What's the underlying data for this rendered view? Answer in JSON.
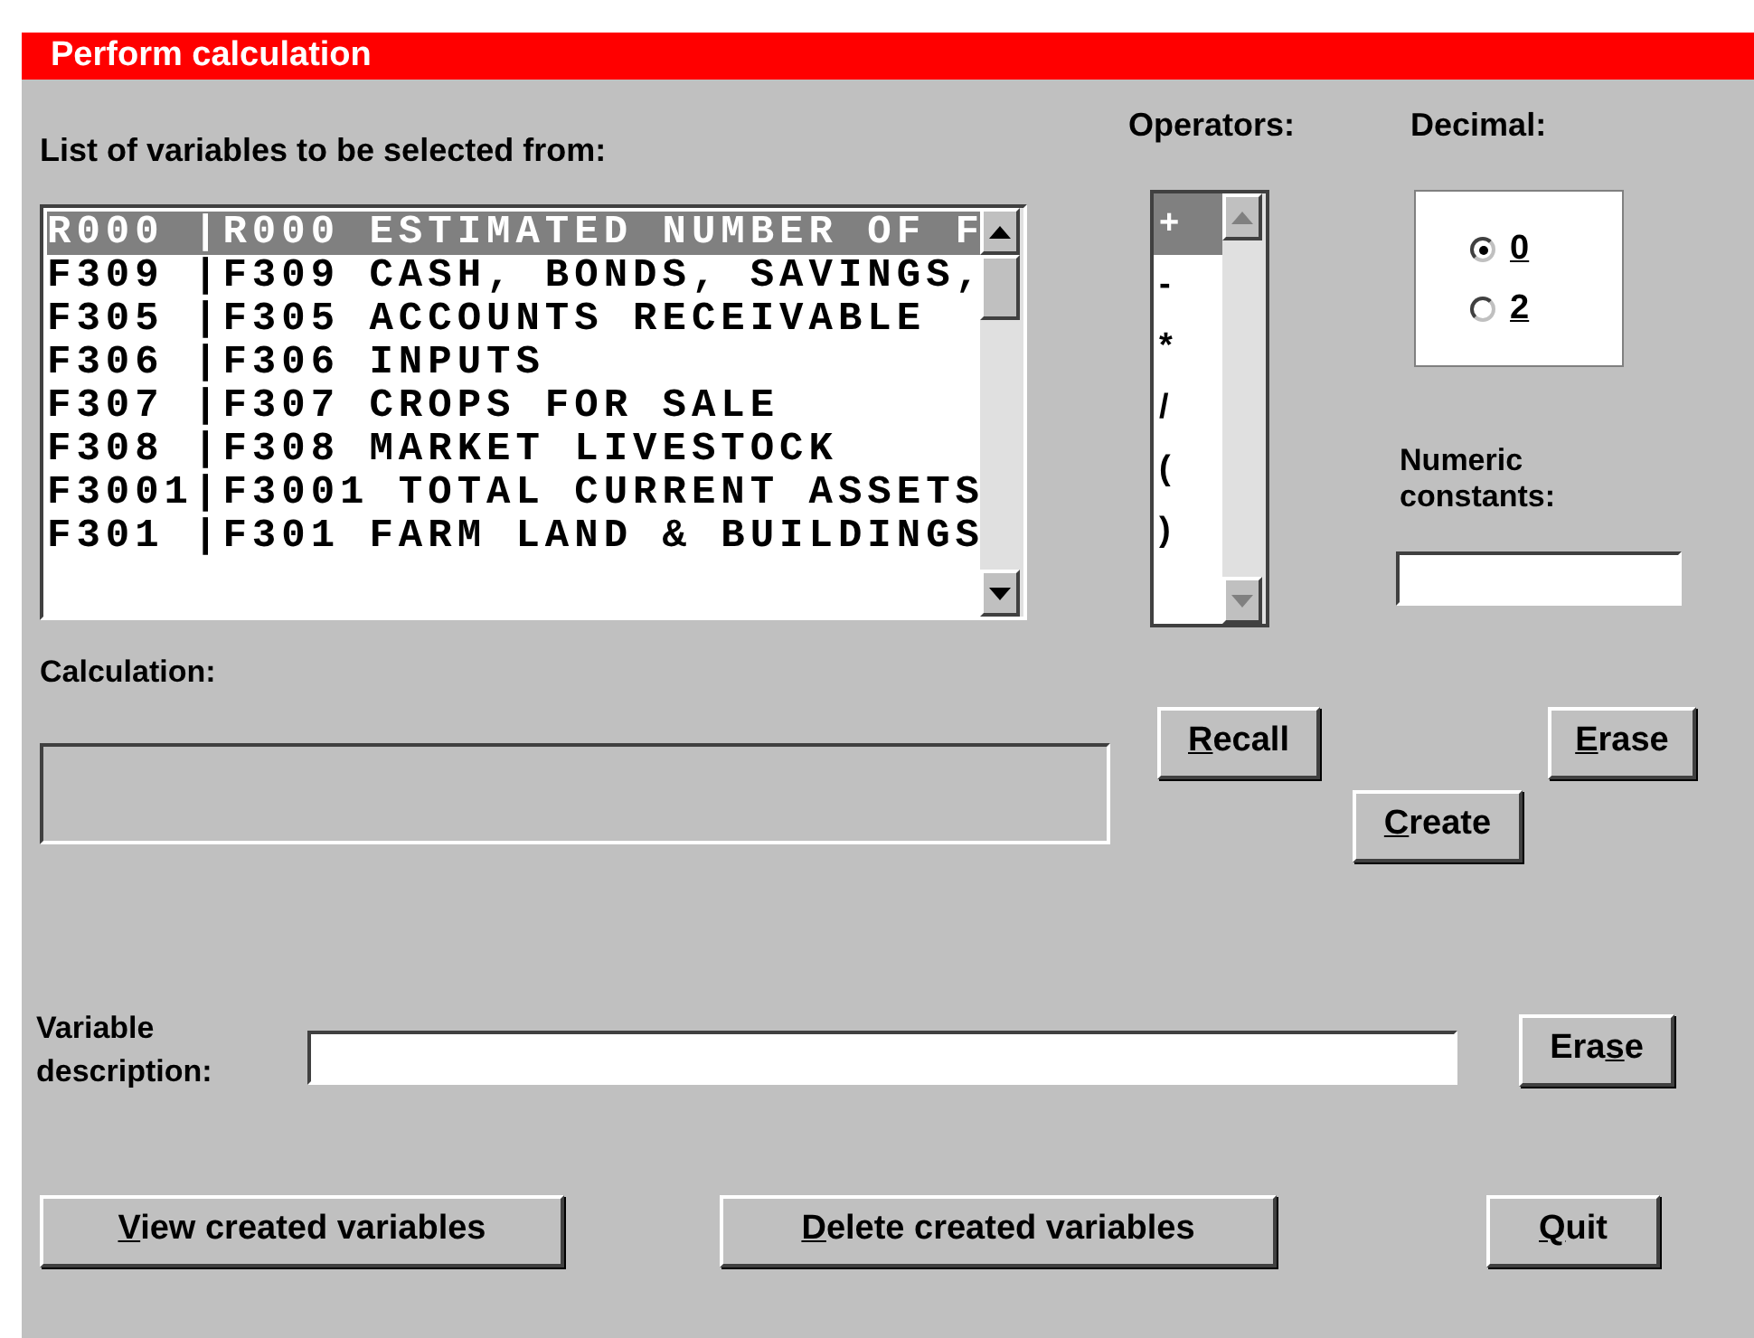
{
  "window": {
    "title": "Perform calculation"
  },
  "variables": {
    "label": "List of variables to be selected from:",
    "items": [
      {
        "text": "R000 |R000 ESTIMATED NUMBER OF F",
        "selected": true
      },
      {
        "text": "F309 |F309 CASH, BONDS, SAVINGS,",
        "selected": false
      },
      {
        "text": "F305 |F305 ACCOUNTS RECEIVABLE",
        "selected": false
      },
      {
        "text": "F306 |F306 INPUTS",
        "selected": false
      },
      {
        "text": "F307 |F307 CROPS FOR SALE",
        "selected": false
      },
      {
        "text": "F308 |F308 MARKET LIVESTOCK",
        "selected": false
      },
      {
        "text": "F3001|F3001 TOTAL CURRENT ASSETS",
        "selected": false
      },
      {
        "text": "F301 |F301 FARM LAND & BUILDINGS",
        "selected": false
      }
    ]
  },
  "operators": {
    "label": "Operators:",
    "items": [
      {
        "text": "+",
        "selected": true
      },
      {
        "text": "-",
        "selected": false
      },
      {
        "text": "*",
        "selected": false
      },
      {
        "text": "/",
        "selected": false
      },
      {
        "text": "(",
        "selected": false
      },
      {
        "text": ")",
        "selected": false
      }
    ]
  },
  "decimal": {
    "label": "Decimal:",
    "options": [
      {
        "label": "0",
        "selected": true
      },
      {
        "label": "2",
        "selected": false
      }
    ]
  },
  "numeric_constants": {
    "label": "Numeric constants:"
  },
  "calculation": {
    "label": "Calculation:"
  },
  "calc_buttons": [
    {
      "parts": [
        {
          "text": "R",
          "underlined": true
        },
        {
          "text": "ecall",
          "underlined": false
        }
      ]
    },
    {
      "parts": [
        {
          "text": "E",
          "underlined": true
        },
        {
          "text": "rase",
          "underlined": false
        }
      ]
    },
    {
      "parts": [
        {
          "text": "C",
          "underlined": true
        },
        {
          "text": "reate",
          "underlined": false
        }
      ]
    }
  ],
  "variable_description": {
    "label": "Variable description:"
  },
  "description_erase": {
    "parts": [
      {
        "text": "Era",
        "underlined": false
      },
      {
        "text": "s",
        "underlined": true
      },
      {
        "text": "e",
        "underlined": false
      }
    ]
  },
  "bottom_buttons": [
    {
      "parts": [
        {
          "text": "V",
          "underlined": true
        },
        {
          "text": "iew created variables",
          "underlined": false
        }
      ]
    },
    {
      "parts": [
        {
          "text": "D",
          "underlined": true
        },
        {
          "text": "elete created variables",
          "underlined": false
        }
      ]
    },
    {
      "parts": [
        {
          "text": "Q",
          "underlined": true
        },
        {
          "text": "uit",
          "underlined": false
        }
      ]
    }
  ]
}
